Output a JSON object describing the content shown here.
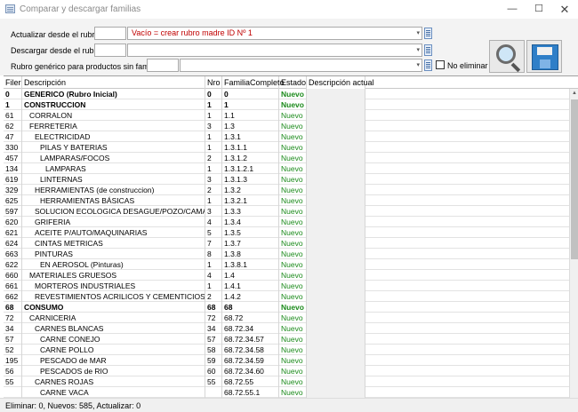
{
  "window": {
    "title": "Comparar y descargar familias",
    "minimize_glyph": "—",
    "maximize_glyph": "☐",
    "close_glyph": "✕"
  },
  "form": {
    "update_label": "Actualizar desde el rubro",
    "update_hint": "Vacío = crear rubro madre ID Nº 1",
    "download_label": "Descargar desde el rubro",
    "generic_label": "Rubro genérico para productos sin familia",
    "no_delete_label": "No eliminar",
    "no_delete_checked": false,
    "combo_arrow": "▾"
  },
  "grid": {
    "headers": [
      "Filer",
      "Descripción",
      "Nro",
      "FamiliaCompleto",
      "Estado",
      "Descripción actual"
    ],
    "rows": [
      {
        "filer": "0",
        "desc": "GENERICO (Rubro Inicial)",
        "indent": 0,
        "nro": "0",
        "fam": "0",
        "estado": "Nuevo",
        "bold": true
      },
      {
        "filer": "1",
        "desc": "CONSTRUCCION",
        "indent": 0,
        "nro": "1",
        "fam": "1",
        "estado": "Nuevo",
        "bold": true
      },
      {
        "filer": "61",
        "desc": "CORRALON",
        "indent": 1,
        "nro": "1",
        "fam": "1.1",
        "estado": "Nuevo",
        "bold": false
      },
      {
        "filer": "62",
        "desc": "FERRETERIA",
        "indent": 1,
        "nro": "3",
        "fam": "1.3",
        "estado": "Nuevo",
        "bold": false
      },
      {
        "filer": "47",
        "desc": "ELECTRICIDAD",
        "indent": 2,
        "nro": "1",
        "fam": "1.3.1",
        "estado": "Nuevo",
        "bold": false
      },
      {
        "filer": "330",
        "desc": "PILAS Y BATERIAS",
        "indent": 3,
        "nro": "1",
        "fam": "1.3.1.1",
        "estado": "Nuevo",
        "bold": false
      },
      {
        "filer": "457",
        "desc": "LAMPARAS/FOCOS",
        "indent": 3,
        "nro": "2",
        "fam": "1.3.1.2",
        "estado": "Nuevo",
        "bold": false
      },
      {
        "filer": "134",
        "desc": "LAMPARAS",
        "indent": 4,
        "nro": "1",
        "fam": "1.3.1.2.1",
        "estado": "Nuevo",
        "bold": false
      },
      {
        "filer": "619",
        "desc": "LINTERNAS",
        "indent": 3,
        "nro": "3",
        "fam": "1.3.1.3",
        "estado": "Nuevo",
        "bold": false
      },
      {
        "filer": "329",
        "desc": "HERRAMIENTAS (de  construccion)",
        "indent": 2,
        "nro": "2",
        "fam": "1.3.2",
        "estado": "Nuevo",
        "bold": false
      },
      {
        "filer": "625",
        "desc": "HERRAMIENTAS BÁSICAS",
        "indent": 3,
        "nro": "1",
        "fam": "1.3.2.1",
        "estado": "Nuevo",
        "bold": false
      },
      {
        "filer": "597",
        "desc": "SOLUCION ECOLOGICA DESAGUE/POZO/CAMARA SEPTICA",
        "indent": 2,
        "nro": "3",
        "fam": "1.3.3",
        "estado": "Nuevo",
        "bold": false
      },
      {
        "filer": "620",
        "desc": "GRIFERIA",
        "indent": 2,
        "nro": "4",
        "fam": "1.3.4",
        "estado": "Nuevo",
        "bold": false
      },
      {
        "filer": "621",
        "desc": "ACEITE P/AUTO/MAQUINARIAS",
        "indent": 2,
        "nro": "5",
        "fam": "1.3.5",
        "estado": "Nuevo",
        "bold": false
      },
      {
        "filer": "624",
        "desc": "CINTAS METRICAS",
        "indent": 2,
        "nro": "7",
        "fam": "1.3.7",
        "estado": "Nuevo",
        "bold": false
      },
      {
        "filer": "663",
        "desc": "PINTURAS",
        "indent": 2,
        "nro": "8",
        "fam": "1.3.8",
        "estado": "Nuevo",
        "bold": false
      },
      {
        "filer": "622",
        "desc": "EN AEROSOL (Pinturas)",
        "indent": 3,
        "nro": "1",
        "fam": "1.3.8.1",
        "estado": "Nuevo",
        "bold": false
      },
      {
        "filer": "660",
        "desc": "MATERIALES GRUESOS",
        "indent": 1,
        "nro": "4",
        "fam": "1.4",
        "estado": "Nuevo",
        "bold": false
      },
      {
        "filer": "661",
        "desc": "MORTEROS INDUSTRIALES",
        "indent": 2,
        "nro": "1",
        "fam": "1.4.1",
        "estado": "Nuevo",
        "bold": false
      },
      {
        "filer": "662",
        "desc": "REVESTIMIENTOS ACRILICOS Y CEMENTICIOS",
        "indent": 2,
        "nro": "2",
        "fam": "1.4.2",
        "estado": "Nuevo",
        "bold": false
      },
      {
        "filer": "68",
        "desc": "CONSUMO",
        "indent": 0,
        "nro": "68",
        "fam": "68",
        "estado": "Nuevo",
        "bold": true
      },
      {
        "filer": "72",
        "desc": "CARNICERIA",
        "indent": 1,
        "nro": "72",
        "fam": "68.72",
        "estado": "Nuevo",
        "bold": false
      },
      {
        "filer": "34",
        "desc": "CARNES BLANCAS",
        "indent": 2,
        "nro": "34",
        "fam": "68.72.34",
        "estado": "Nuevo",
        "bold": false
      },
      {
        "filer": "57",
        "desc": "CARNE CONEJO",
        "indent": 3,
        "nro": "57",
        "fam": "68.72.34.57",
        "estado": "Nuevo",
        "bold": false
      },
      {
        "filer": "52",
        "desc": "CARNE POLLO",
        "indent": 3,
        "nro": "58",
        "fam": "68.72.34.58",
        "estado": "Nuevo",
        "bold": false
      },
      {
        "filer": "195",
        "desc": "PESCADO de MAR",
        "indent": 3,
        "nro": "59",
        "fam": "68.72.34.59",
        "estado": "Nuevo",
        "bold": false
      },
      {
        "filer": "56",
        "desc": "PESCADOS de RIO",
        "indent": 3,
        "nro": "60",
        "fam": "68.72.34.60",
        "estado": "Nuevo",
        "bold": false
      },
      {
        "filer": "55",
        "desc": "CARNES ROJAS",
        "indent": 2,
        "nro": "55",
        "fam": "68.72.55",
        "estado": "Nuevo",
        "bold": false
      },
      {
        "filer": "",
        "desc": "CARNE VACA",
        "indent": 3,
        "nro": "",
        "fam": "68.72.55.1",
        "estado": "Nuevo",
        "bold": false
      }
    ]
  },
  "status": {
    "text": "Eliminar: 0, Nuevos: 585, Actualizar: 0"
  },
  "colors": {
    "estado_nuevo": "#1a8a1a",
    "hint_red": "#c00000"
  },
  "icons": {
    "app": "table-icon",
    "dropdown_buttons": "list-icon",
    "search": "magnifier-icon",
    "download": "save-disk-icon"
  }
}
